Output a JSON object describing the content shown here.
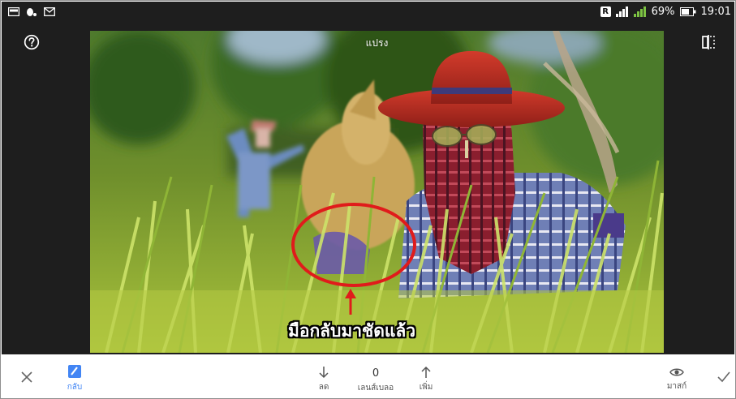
{
  "status_bar": {
    "badge_r": "R",
    "battery_percent": "69%",
    "time": "19:01"
  },
  "editor": {
    "tool_title": "แปรง",
    "annotation_text": "มือกลับมาชัดแล้ว"
  },
  "toolbar": {
    "back_label": "กลับ",
    "decrease_label": "ลด",
    "value": "0",
    "value_label": "เลนส์เบลอ",
    "increase_label": "เพิ่ม",
    "mask_label": "มาสก์",
    "accent_color": "#4285f4"
  },
  "annotation_color": "#e01b1b"
}
